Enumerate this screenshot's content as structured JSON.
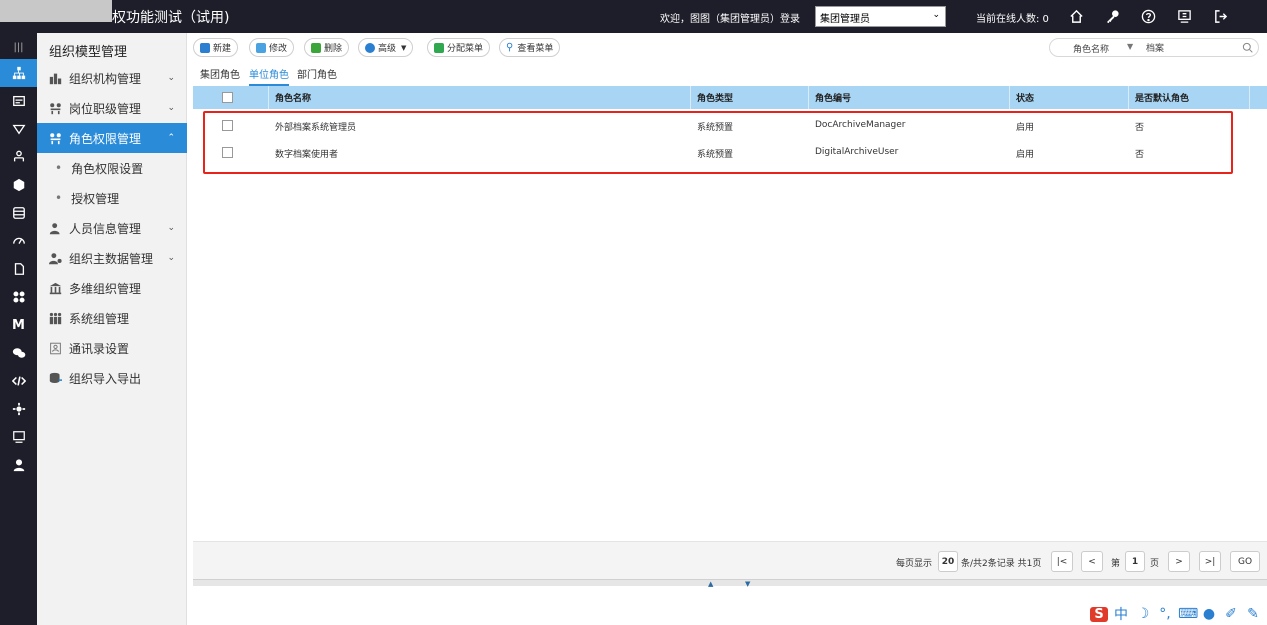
{
  "header": {
    "app_title": "权功能测试（试用)",
    "welcome": "欢迎，图图（集团管理员）登录",
    "role_selected": "集团管理员",
    "online_count": "当前在线人数: 0"
  },
  "sidebar": {
    "title": "组织模型管理",
    "items": [
      {
        "label": "组织机构管理"
      },
      {
        "label": "岗位职级管理"
      },
      {
        "label": "角色权限管理"
      },
      {
        "label": "角色权限设置"
      },
      {
        "label": "授权管理"
      },
      {
        "label": "人员信息管理"
      },
      {
        "label": "组织主数据管理"
      },
      {
        "label": "多维组织管理"
      },
      {
        "label": "系统组管理"
      },
      {
        "label": "通讯录设置"
      },
      {
        "label": "组织导入导出"
      }
    ]
  },
  "toolbar": {
    "new": "新建",
    "edit": "修改",
    "delete": "删除",
    "advanced": "高级",
    "assign_menu": "分配菜单",
    "view_menu": "查看菜单"
  },
  "search": {
    "field": "角色名称",
    "value": "档案"
  },
  "tabs": [
    "集团角色",
    "单位角色",
    "部门角色"
  ],
  "table": {
    "columns": [
      "角色名称",
      "角色类型",
      "角色编号",
      "状态",
      "是否默认角色"
    ],
    "rows": [
      [
        "外部档案系统管理员",
        "系统预置",
        "DocArchiveManager",
        "启用",
        "否"
      ],
      [
        "数字档案使用者",
        "系统预置",
        "DigitalArchiveUser",
        "启用",
        "否"
      ]
    ]
  },
  "pager": {
    "per_page_label": "每页显示",
    "per_page": "20",
    "summary": "条/共2条记录 共1页",
    "page_prefix": "第",
    "page": "1",
    "page_suffix": "页",
    "go": "GO"
  },
  "colors": {
    "accent": "#2a8bd8",
    "highlight": "#e8231a",
    "header_bg": "#1e1e2a"
  }
}
